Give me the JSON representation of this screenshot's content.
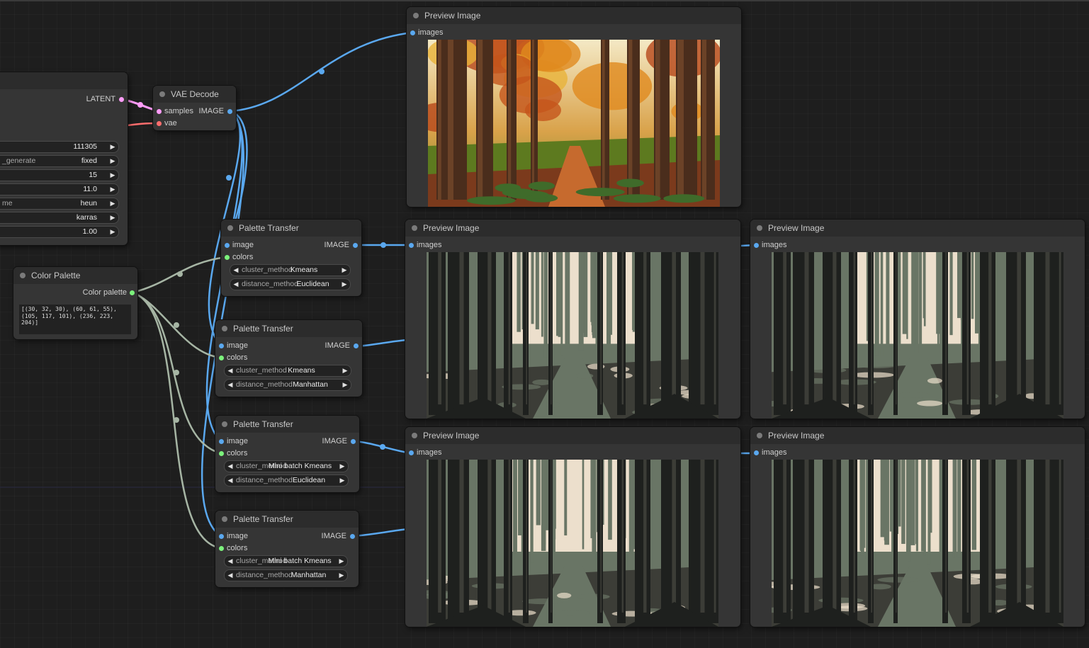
{
  "canvas": {
    "colors": {
      "background": "#1e1e1e",
      "node": "#353535",
      "image_wire": "#5aa8ef",
      "latent_wire": "#ff9cf9",
      "vae_wire": "#ff6e6e",
      "color_wire": "#a6b5a4"
    }
  },
  "ksampler": {
    "output_label": "LATENT",
    "widgets": [
      {
        "name": "",
        "value": "111305"
      },
      {
        "name": "_generate",
        "value": "fixed"
      },
      {
        "name": "",
        "value": "15"
      },
      {
        "name": "",
        "value": "11.0"
      },
      {
        "name": "me",
        "value": "heun"
      },
      {
        "name": "",
        "value": "karras"
      },
      {
        "name": "",
        "value": "1.00"
      }
    ]
  },
  "vae_decode": {
    "title": "VAE Decode",
    "inputs": [
      "samples",
      "vae"
    ],
    "output": "IMAGE"
  },
  "color_palette": {
    "title": "Color Palette",
    "output": "Color palette",
    "text": "[(30, 32, 30), (60, 61, 55),\n(105, 117, 101), (236, 223,\n204)]"
  },
  "palette_transfers": [
    {
      "title": "Palette Transfer",
      "input_image": "image",
      "input_colors": "colors",
      "output": "IMAGE",
      "cluster_label": "cluster_method",
      "cluster_value": "Kmeans",
      "distance_label": "distance_method",
      "distance_value": "Euclidean"
    },
    {
      "title": "Palette Transfer",
      "input_image": "image",
      "input_colors": "colors",
      "output": "IMAGE",
      "cluster_label": "cluster_method",
      "cluster_value": "Kmeans",
      "distance_label": "distance_method",
      "distance_value": "Manhattan"
    },
    {
      "title": "Palette Transfer",
      "input_image": "image",
      "input_colors": "colors",
      "output": "IMAGE",
      "cluster_label": "cluster_method",
      "cluster_value": "Mini batch Kmeans",
      "distance_label": "distance_method",
      "distance_value": "Euclidean"
    },
    {
      "title": "Palette Transfer",
      "input_image": "image",
      "input_colors": "colors",
      "output": "IMAGE",
      "cluster_label": "cluster_method",
      "cluster_value": "Mini batch Kmeans",
      "distance_label": "distance_method",
      "distance_value": "Manhattan"
    }
  ],
  "previews": [
    {
      "title": "Preview Image",
      "input": "images"
    },
    {
      "title": "Preview Image",
      "input": "images"
    },
    {
      "title": "Preview Image",
      "input": "images"
    },
    {
      "title": "Preview Image",
      "input": "images"
    },
    {
      "title": "Preview Image",
      "input": "images"
    }
  ]
}
